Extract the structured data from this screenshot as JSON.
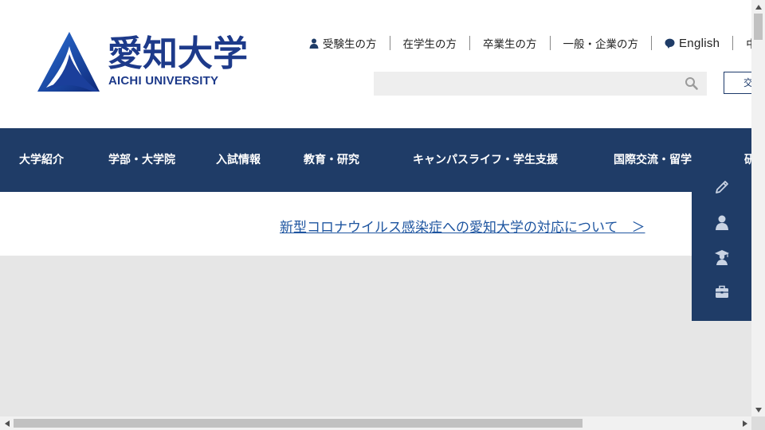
{
  "logo": {
    "name_jp": "愛知大学",
    "name_en": "AICHI UNIVERSITY"
  },
  "util_nav": [
    {
      "label": "受験生の方",
      "icon": "person-icon"
    },
    {
      "label": "在学生の方"
    },
    {
      "label": "卒業生の方"
    },
    {
      "label": "一般・企業の方"
    },
    {
      "label": "English",
      "icon": "speech-bubble-icon"
    },
    {
      "label": "中"
    }
  ],
  "search": {
    "placeholder": ""
  },
  "access_button": {
    "label": "交"
  },
  "global_nav": [
    {
      "label": "大学紹介"
    },
    {
      "label": "学部・大学院"
    },
    {
      "label": "入試情報"
    },
    {
      "label": "教育・研究"
    },
    {
      "label": "キャンパスライフ・学生支援"
    },
    {
      "label": "国際交流・留学"
    },
    {
      "label": "研"
    }
  ],
  "notice": {
    "link_text": "新型コロナウイルス感染症への愛知大学の対応について　＞"
  },
  "side_panel": [
    {
      "icon": "pencil-icon"
    },
    {
      "icon": "person-icon"
    },
    {
      "icon": "graduate-icon"
    },
    {
      "icon": "briefcase-icon"
    }
  ],
  "colors": {
    "brand_navy": "#1f3c67",
    "logo_blue": "#1d3a8a",
    "link_blue": "#1e55a0",
    "hero_gray": "#e6e6e6"
  }
}
